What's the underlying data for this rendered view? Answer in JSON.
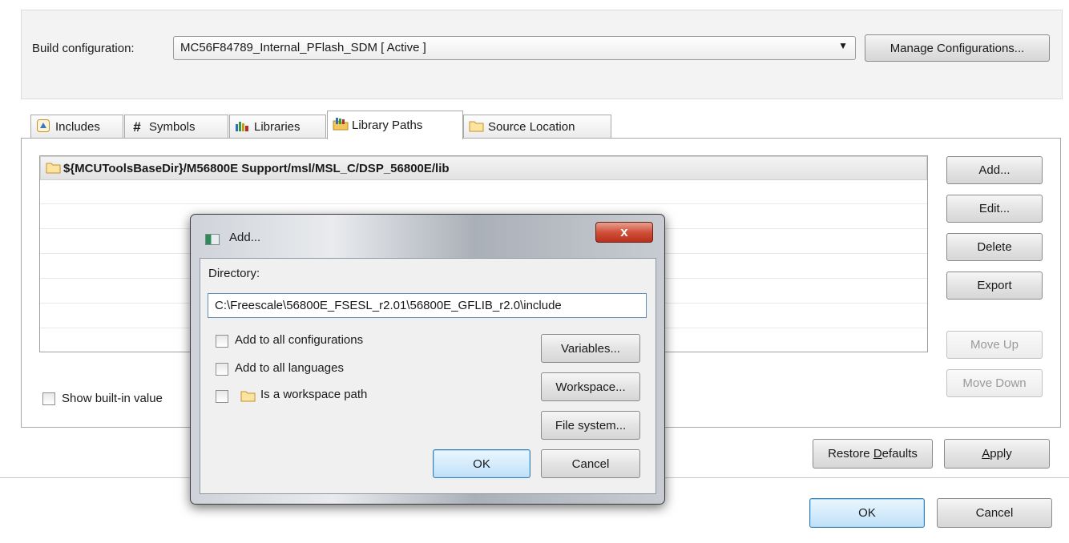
{
  "build_config": {
    "label": "Build configuration:",
    "value": "MC56F84789_Internal_PFlash_SDM  [ Active ]",
    "manage_button": "Manage Configurations..."
  },
  "tabs": [
    {
      "label": "Includes",
      "icon": "includes-icon"
    },
    {
      "label": "Symbols",
      "icon": "hash-icon"
    },
    {
      "label": "Libraries",
      "icon": "libraries-icon"
    },
    {
      "label": "Library Paths",
      "icon": "library-paths-icon",
      "active": true
    },
    {
      "label": "Source Location",
      "icon": "folder-icon"
    }
  ],
  "library_paths": {
    "items": [
      "${MCUToolsBaseDir}/M56800E Support/msl/MSL_C/DSP_56800E/lib"
    ]
  },
  "side_buttons": {
    "add": "Add...",
    "edit": "Edit...",
    "delete": "Delete",
    "export": "Export",
    "move_up": "Move Up",
    "move_down": "Move Down"
  },
  "show_builtin_label": "Show built-in value",
  "bottom": {
    "restore_prefix": "Restore ",
    "restore_mnemonic": "D",
    "restore_suffix": "efaults",
    "apply_mnemonic": "A",
    "apply_suffix": "pply",
    "ok": "OK",
    "cancel": "Cancel"
  },
  "dialog": {
    "title": "Add...",
    "close": "x",
    "directory_label": "Directory:",
    "directory_value": "C:\\Freescale\\56800E_FSESL_r2.01\\56800E_GFLIB_r2.0\\include",
    "opt_all_configs": "Add to all configurations",
    "opt_all_languages": "Add to all languages",
    "opt_workspace_path": "Is a workspace path",
    "variables": "Variables...",
    "workspace": "Workspace...",
    "file_system": "File system...",
    "ok": "OK",
    "cancel": "Cancel"
  }
}
